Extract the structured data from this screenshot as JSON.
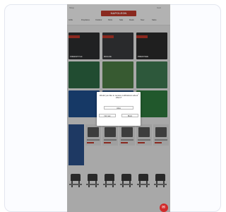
{
  "header": {
    "brand": "NAPOLEON",
    "top_left": "Shop",
    "cart": "Cart"
  },
  "nav": {
    "tabs": [
      "Grills",
      "Fireplaces",
      "Outdoor",
      "Parts",
      "Sale",
      "Deals",
      "New",
      "Sales"
    ]
  },
  "tiles": [
    {
      "label": "FREESTYLE",
      "bg": "#2d2f30"
    },
    {
      "label": "ROGUE",
      "bg": "#3a3b3d"
    },
    {
      "label": "PRESTIGE",
      "bg": "#2b2b2b"
    },
    {
      "label": "",
      "bg": "#2f6a45"
    },
    {
      "label": "",
      "bg": "#4d7d45"
    },
    {
      "label": "",
      "bg": "#3f7a52"
    },
    {
      "label": "",
      "bg": "#1f4f8e"
    },
    {
      "label": "",
      "bg": "#1b4a83"
    },
    {
      "label": "",
      "bg": "#2f7a3e"
    }
  ],
  "modal": {
    "title": "Would you like to receive notifications about offers?",
    "option_a": "Allow",
    "option_b": "Not now",
    "option_c": "Block",
    "close": "×"
  },
  "chat": {
    "icon": "chat-icon"
  }
}
